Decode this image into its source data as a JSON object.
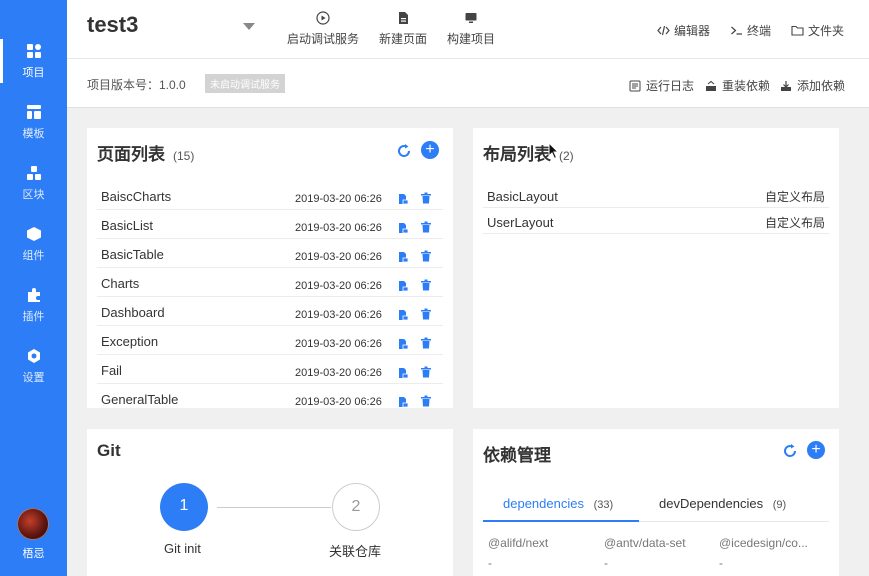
{
  "sidebar": {
    "items": [
      {
        "label": "项目",
        "icon": "project-icon"
      },
      {
        "label": "模板",
        "icon": "template-icon"
      },
      {
        "label": "区块",
        "icon": "block-icon"
      },
      {
        "label": "组件",
        "icon": "component-icon"
      },
      {
        "label": "插件",
        "icon": "plugin-icon"
      },
      {
        "label": "设置",
        "icon": "settings-icon"
      }
    ],
    "user_name": "梧忌"
  },
  "header": {
    "project_title": "test3",
    "actions": [
      "启动调试服务",
      "新建页面",
      "构建项目"
    ],
    "right_actions": [
      "编辑器",
      "终端",
      "文件夹"
    ]
  },
  "subheader": {
    "version": "项目版本号：1.0.0",
    "status_badge": "未启动调试服务",
    "actions": [
      "运行日志",
      "重装依赖",
      "添加依赖"
    ]
  },
  "pages_card": {
    "title": "页面列表",
    "count": "(15)",
    "rows": [
      {
        "name": "BaiscCharts",
        "date": "2019-03-20 06:26"
      },
      {
        "name": "BasicList",
        "date": "2019-03-20 06:26"
      },
      {
        "name": "BasicTable",
        "date": "2019-03-20 06:26"
      },
      {
        "name": "Charts",
        "date": "2019-03-20 06:26"
      },
      {
        "name": "Dashboard",
        "date": "2019-03-20 06:26"
      },
      {
        "name": "Exception",
        "date": "2019-03-20 06:26"
      },
      {
        "name": "Fail",
        "date": "2019-03-20 06:26"
      },
      {
        "name": "GeneralTable",
        "date": "2019-03-20 06:26"
      }
    ]
  },
  "layouts_card": {
    "title": "布局列表",
    "count": "(2)",
    "rows": [
      {
        "name": "BasicLayout",
        "type": "自定义布局"
      },
      {
        "name": "UserLayout",
        "type": "自定义布局"
      }
    ]
  },
  "git_card": {
    "title": "Git",
    "steps": [
      {
        "number": "1",
        "label": "Git init"
      },
      {
        "number": "2",
        "label": "关联仓库"
      }
    ]
  },
  "deps_card": {
    "title": "依赖管理",
    "tabs": [
      {
        "label": "dependencies",
        "count": "(33)"
      },
      {
        "label": "devDependencies",
        "count": "(9)"
      }
    ],
    "items": [
      {
        "name": "@alifd/next",
        "version": "-"
      },
      {
        "name": "@antv/data-set",
        "version": "-"
      },
      {
        "name": "@icedesign/co...",
        "version": "-"
      }
    ]
  },
  "colors": {
    "accent": "#2d7df6",
    "sidebar": "#2d7df6"
  }
}
